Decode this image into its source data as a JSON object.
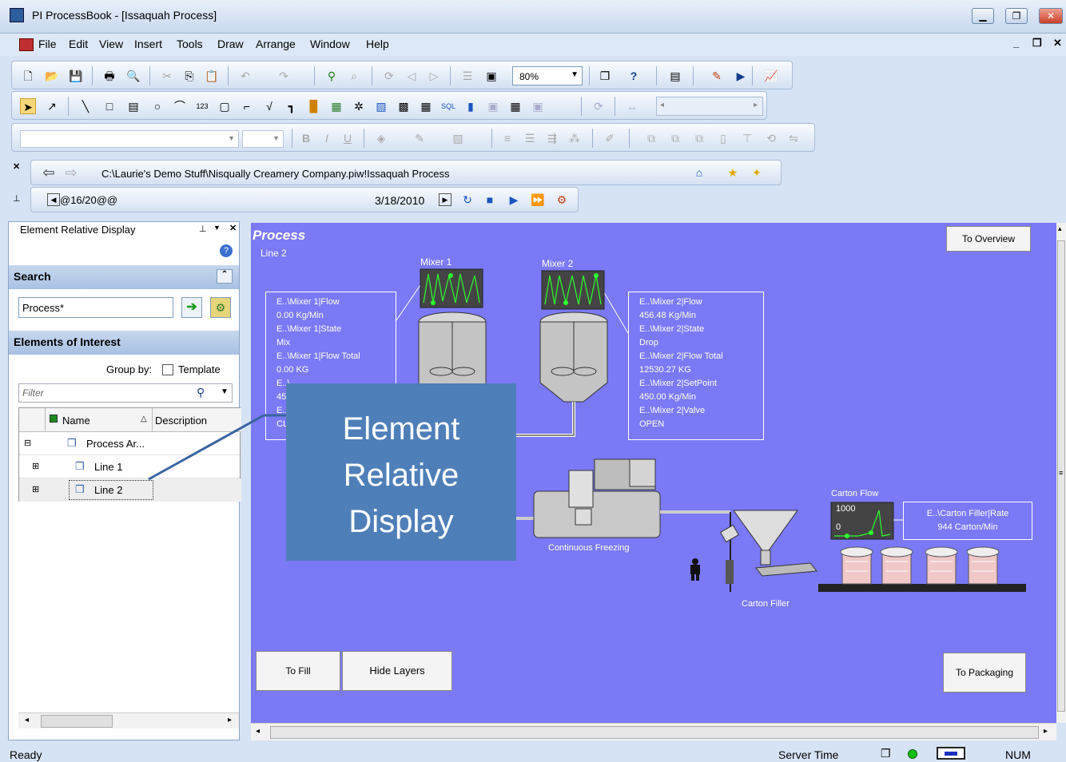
{
  "window": {
    "title": "PI ProcessBook - [Issaquah Process]"
  },
  "menu": {
    "items": [
      "File",
      "Edit",
      "View",
      "Insert",
      "Tools",
      "Draw",
      "Arrange",
      "Window",
      "Help"
    ]
  },
  "toolbar": {
    "zoom": "80%"
  },
  "nav": {
    "path": "C:\\Laurie's Demo Stuff\\Nisqually Creamery Company.piw!Issaquah Process",
    "start_time": "@16/20@@",
    "end_time": "3/18/2010"
  },
  "leftpane": {
    "title": "Element Relative Display",
    "search_header": "Search",
    "search_value": "Process*",
    "elements_header": "Elements of Interest",
    "group_by": "Group by:",
    "template_label": "Template",
    "filter_placeholder": "Filter",
    "col_name": "Name",
    "col_description": "Description",
    "tree": [
      {
        "label": "Process Ar..."
      },
      {
        "label": "Line 1"
      },
      {
        "label": "Line 2"
      }
    ]
  },
  "display": {
    "title": "Process",
    "subtitle": "Line 2",
    "mixer1_label": "Mixer 1",
    "mixer2_label": "Mixer 2",
    "mixer1_box": [
      "E..\\Mixer 1|Flow",
      "0.00 Kg/Min",
      "E..\\Mixer 1|State",
      "Mix",
      "E..\\Mixer 1|Flow Total",
      "0.00 KG",
      "E..\\",
      "450",
      "E..\\",
      "CL"
    ],
    "mixer2_box": [
      "E..\\Mixer 2|Flow",
      "456.48 Kg/Min",
      "E..\\Mixer 2|State",
      "Drop",
      "E..\\Mixer 2|Flow Total",
      "12530.27 KG",
      "E..\\Mixer 2|SetPoint",
      "450.00 Kg/Min",
      "E..\\Mixer 2|Valve",
      "OPEN"
    ],
    "freezing_label": "Continuous Freezing",
    "carton_filler_label": "Carton Filler",
    "carton_flow_label": "Carton Flow",
    "carton_flow_max": "1000",
    "carton_flow_min": "0",
    "carton_box": [
      "E..\\Carton Filler|Rate",
      "944 Carton/Min"
    ],
    "btn_overview": "To Overview",
    "btn_fill": "To Fill",
    "btn_hide_layers": "Hide Layers",
    "btn_packaging": "To Packaging"
  },
  "callout": {
    "lines": [
      "Element",
      "Relative",
      "Display"
    ]
  },
  "status": {
    "text": "Ready",
    "server_time": "Server Time",
    "num": "NUM"
  },
  "colors": {
    "display_bg": "#7b79f6",
    "callout_bg": "#4f7fb8",
    "status_ok": "#11c011"
  }
}
